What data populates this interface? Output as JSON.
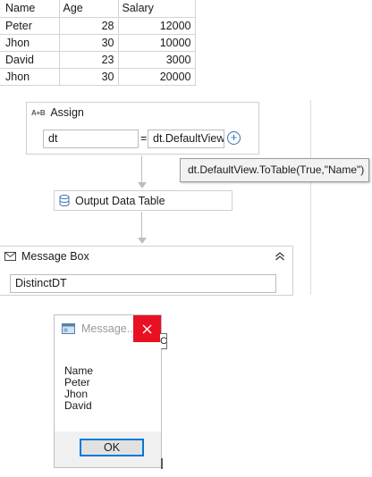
{
  "table": {
    "headers": [
      "Name",
      "Age",
      "Salary"
    ],
    "rows": [
      [
        "Peter",
        "28",
        "12000"
      ],
      [
        "Jhon",
        "30",
        "10000"
      ],
      [
        "David",
        "23",
        "3000"
      ],
      [
        "Jhon",
        "30",
        "20000"
      ]
    ]
  },
  "assign": {
    "icon_text": "A+B",
    "title": "Assign",
    "to_value": "dt",
    "equals": "=",
    "value": "dt.DefaultView",
    "add_icon": "plus-circle-icon"
  },
  "tooltip": {
    "text": "dt.DefaultView.ToTable(True,\"Name\")"
  },
  "output_data_table": {
    "title": "Output Data Table",
    "icon": "data-table-icon"
  },
  "message_box_activity": {
    "title": "Message Box",
    "text_value": "DistinctDT",
    "icon": "envelope-icon",
    "collapse_icon": "double-chevron-up-icon"
  },
  "dialog": {
    "title": "Message...",
    "close_symbol": "✕",
    "overflow_char": "C",
    "lines": [
      "Name",
      "Peter",
      "Jhon",
      "David"
    ],
    "ok_label": "OK"
  },
  "colors": {
    "close_red": "#e81123",
    "focus_blue": "#0078d7",
    "add_blue": "#3b6fb4"
  }
}
